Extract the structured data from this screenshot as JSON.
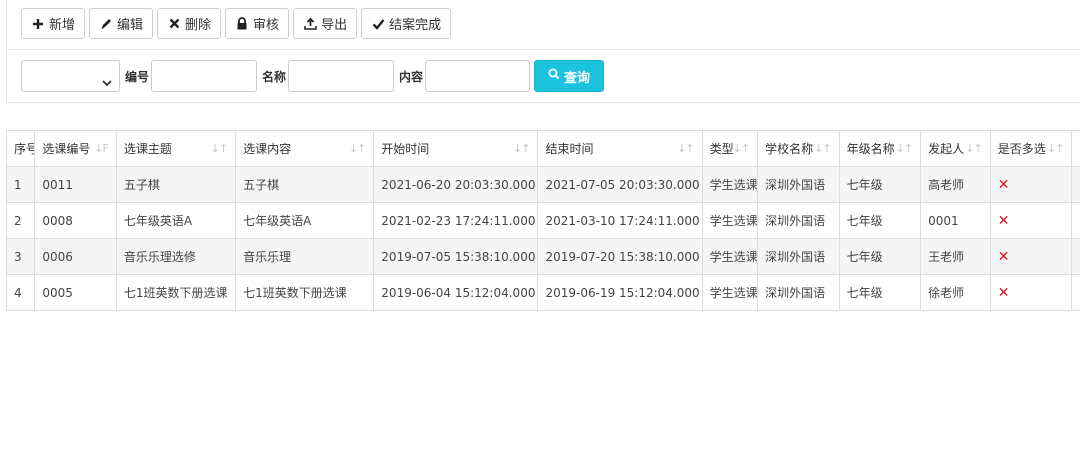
{
  "toolbar": {
    "add_label": "新增",
    "edit_label": "编辑",
    "delete_label": "删除",
    "review_label": "审核",
    "export_label": "导出",
    "close_case_label": "结案完成"
  },
  "search": {
    "select_value": "",
    "code_label": "编号",
    "code_value": "",
    "name_label": "名称",
    "name_value": "",
    "content_label": "内容",
    "content_value": "",
    "query_label": "查询"
  },
  "table": {
    "columns": [
      "序号",
      "选课编号",
      "选课主题",
      "选课内容",
      "开始时间",
      "结束时间",
      "类型",
      "学校名称",
      "年级名称",
      "发起人",
      "是否多选"
    ],
    "rows": [
      {
        "index": "1",
        "code": "0011",
        "topic": "五子棋",
        "content": "五子棋",
        "start": "2021-06-20 20:03:30.000",
        "end": "2021-07-05 20:03:30.000",
        "type": "学生选课",
        "school": "深圳外国语",
        "grade": "七年级",
        "initiator": "高老师",
        "multi": "✕"
      },
      {
        "index": "2",
        "code": "0008",
        "topic": "七年级英语A",
        "content": "七年级英语A",
        "start": "2021-02-23 17:24:11.000",
        "end": "2021-03-10 17:24:11.000",
        "type": "学生选课",
        "school": "深圳外国语",
        "grade": "七年级",
        "initiator": "0001",
        "multi": "✕"
      },
      {
        "index": "3",
        "code": "0006",
        "topic": "音乐乐理选修",
        "content": "音乐乐理",
        "start": "2019-07-05 15:38:10.000",
        "end": "2019-07-20 15:38:10.000",
        "type": "学生选课",
        "school": "深圳外国语",
        "grade": "七年级",
        "initiator": "王老师",
        "multi": "✕"
      },
      {
        "index": "4",
        "code": "0005",
        "topic": "七1班英数下册选课",
        "content": "七1班英数下册选课",
        "start": "2019-06-04 15:12:04.000",
        "end": "2019-06-19 15:12:04.000",
        "type": "学生选课",
        "school": "深圳外国语",
        "grade": "七年级",
        "initiator": "徐老师",
        "multi": "✕"
      }
    ]
  },
  "colors": {
    "query_button": "#1cc3de",
    "cross_mark": "#d9141c",
    "striped_row": "#f5f5f5"
  },
  "icons": {
    "add": "plus-icon",
    "edit": "pencil-icon",
    "delete": "x-icon",
    "review": "lock-icon",
    "export": "export-icon",
    "close_case": "check-icon",
    "query": "search-icon",
    "sort": "sort-icon"
  }
}
